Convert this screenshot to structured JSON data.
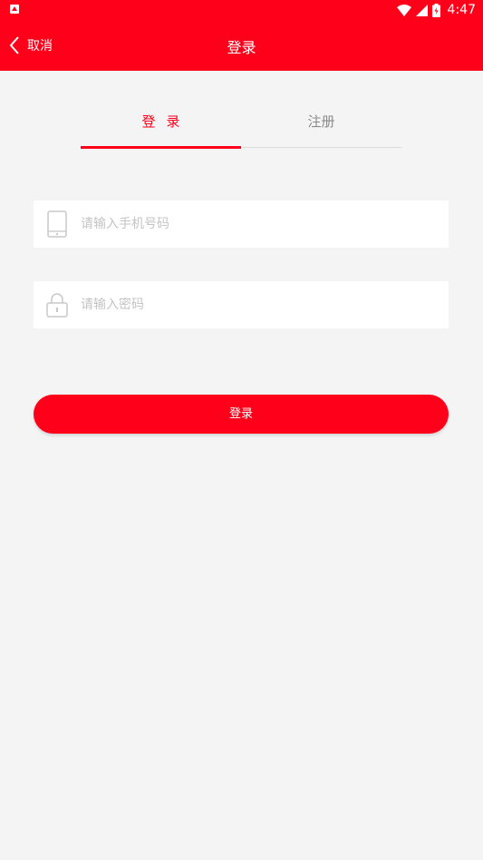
{
  "status_bar": {
    "time": "4:47",
    "icons": [
      "app-notification-icon",
      "wifi-icon",
      "signal-icon",
      "battery-charging-icon"
    ]
  },
  "nav": {
    "back_label": "取消",
    "title": "登录"
  },
  "tabs": {
    "login_label": "登录",
    "register_label": "注册",
    "active": "login"
  },
  "form": {
    "phone_placeholder": "请输入手机号码",
    "phone_value": "",
    "password_placeholder": "请输入密码",
    "password_value": "",
    "submit_label": "登录"
  },
  "colors": {
    "brand": "#ff001a",
    "background": "#f4f4f4",
    "placeholder": "#c4c4c4",
    "tab_inactive": "#8a8a8a"
  }
}
